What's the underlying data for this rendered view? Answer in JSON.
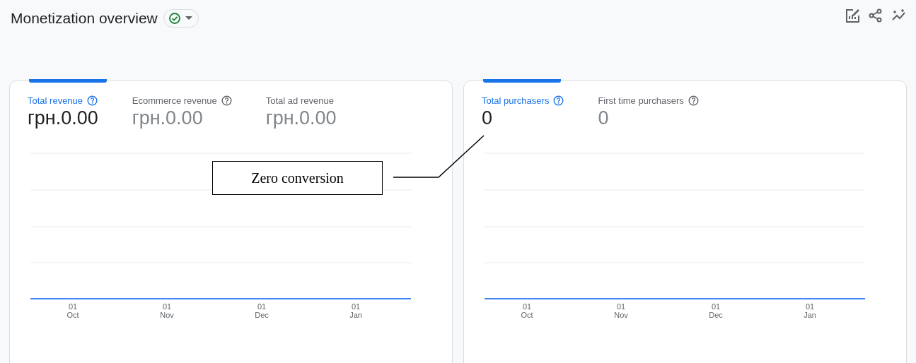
{
  "header": {
    "title": "Monetization overview",
    "status_ok": true
  },
  "cards": [
    {
      "metrics": [
        {
          "label": "Total revenue",
          "value": "грн.0.00",
          "selected": true,
          "help": true
        },
        {
          "label": "Ecommerce revenue",
          "value": "грн.0.00",
          "selected": false,
          "help": true
        },
        {
          "label": "Total ad revenue",
          "value": "грн.0.00",
          "selected": false,
          "help": false
        }
      ],
      "x_labels": [
        {
          "day": "01",
          "month": "Oct"
        },
        {
          "day": "01",
          "month": "Nov"
        },
        {
          "day": "01",
          "month": "Dec"
        },
        {
          "day": "01",
          "month": "Jan"
        }
      ]
    },
    {
      "metrics": [
        {
          "label": "Total purchasers",
          "value": "0",
          "selected": true,
          "help": true
        },
        {
          "label": "First time purchasers",
          "value": "0",
          "selected": false,
          "help": true
        }
      ],
      "x_labels": [
        {
          "day": "01",
          "month": "Oct"
        },
        {
          "day": "01",
          "month": "Nov"
        },
        {
          "day": "01",
          "month": "Dec"
        },
        {
          "day": "01",
          "month": "Jan"
        }
      ]
    }
  ],
  "annotation": {
    "text": "Zero conversion"
  }
}
